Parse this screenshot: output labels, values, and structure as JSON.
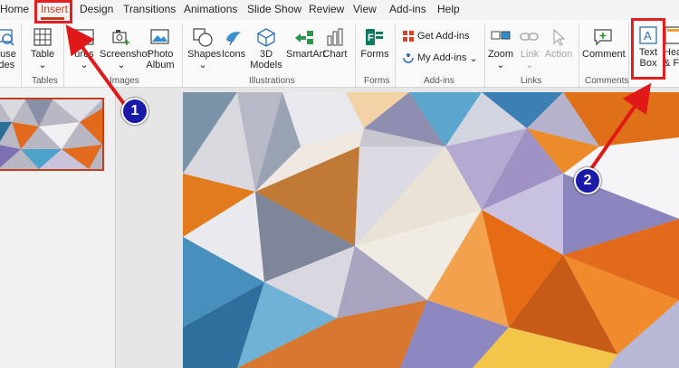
{
  "tabs": [
    {
      "label": "Home"
    },
    {
      "label": "Insert"
    },
    {
      "label": "Design"
    },
    {
      "label": "Transitions"
    },
    {
      "label": "Animations"
    },
    {
      "label": "Slide Show"
    },
    {
      "label": "Review"
    },
    {
      "label": "View"
    },
    {
      "label": "Add-ins"
    },
    {
      "label": "Help"
    }
  ],
  "ribbon": {
    "reuse": {
      "line1": "euse",
      "line2": "ides"
    },
    "table": {
      "label": "Table"
    },
    "pictures": {
      "label": "ures"
    },
    "screenshot": {
      "label": "Screenshot"
    },
    "photo_album": {
      "line1": "Photo",
      "line2": "Album"
    },
    "shapes": {
      "label": "Shapes"
    },
    "icons": {
      "label": "Icons"
    },
    "models_3d": {
      "line1": "3D",
      "line2": "Models"
    },
    "smartart": {
      "label": "SmartArt"
    },
    "chart": {
      "label": "Chart"
    },
    "forms": {
      "label": "Forms"
    },
    "get_addins": {
      "label": "Get Add-ins"
    },
    "my_addins": {
      "label": "My Add-ins"
    },
    "zoom": {
      "label": "Zoom"
    },
    "link": {
      "label": "Link"
    },
    "action": {
      "label": "Action"
    },
    "comment": {
      "label": "Comment"
    },
    "text_box": {
      "line1": "Text",
      "line2": "Box"
    },
    "header_footer": {
      "line1": "Hea",
      "line2": "& Fo"
    },
    "groups": {
      "tables": "Tables",
      "images": "Images",
      "illustrations": "Illustrations",
      "forms": "Forms",
      "addins": "Add-ins",
      "links": "Links",
      "comments": "Comments"
    }
  },
  "annotations": {
    "step1": "1",
    "step2": "2"
  },
  "colors": {
    "accent": "#c43e1c",
    "highlight": "#e02020",
    "badge": "#1a1aa8"
  }
}
